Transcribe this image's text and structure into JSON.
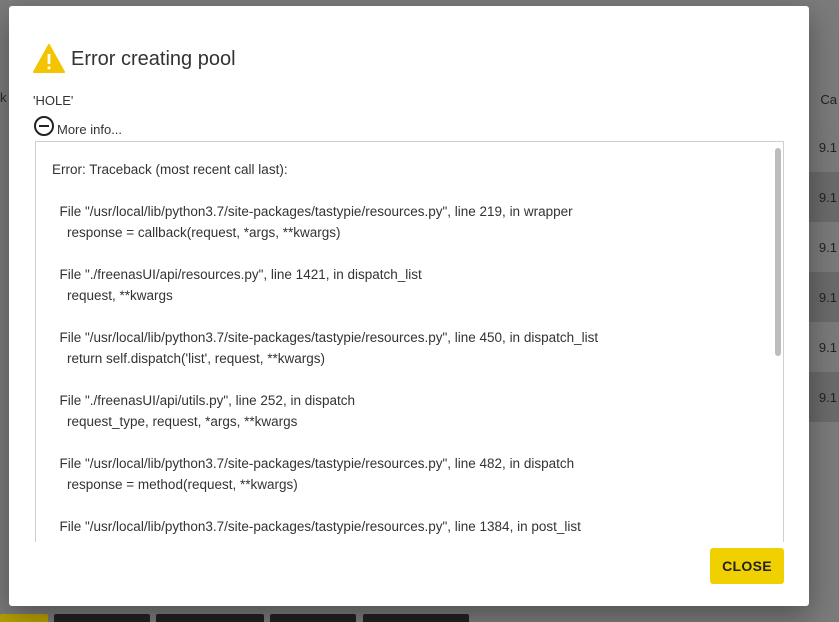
{
  "dialog": {
    "title": "Error creating pool",
    "message": "'HOLE'",
    "more_info_label": "More info...",
    "traceback": "Error: Traceback (most recent call last):\n\n  File \"/usr/local/lib/python3.7/site-packages/tastypie/resources.py\", line 219, in wrapper\n    response = callback(request, *args, **kwargs)\n\n  File \"./freenasUI/api/resources.py\", line 1421, in dispatch_list\n    request, **kwargs\n\n  File \"/usr/local/lib/python3.7/site-packages/tastypie/resources.py\", line 450, in dispatch_list\n    return self.dispatch('list', request, **kwargs)\n\n  File \"./freenasUI/api/utils.py\", line 252, in dispatch\n    request_type, request, *args, **kwargs\n\n  File \"/usr/local/lib/python3.7/site-packages/tastypie/resources.py\", line 482, in dispatch\n    response = method(request, **kwargs)\n\n  File \"/usr/local/lib/python3.7/site-packages/tastypie/resources.py\", line 1384, in post_list",
    "close_label": "CLOSE",
    "icons": {
      "warning": "warning-icon",
      "collapse": "minus-circle-icon"
    }
  },
  "background": {
    "header_partial": "Ca",
    "left_partial": "k",
    "values": [
      "9.1",
      "9.1",
      "9.1",
      "9.1",
      "9.1",
      "9.1"
    ]
  },
  "colors": {
    "accent": "#f0d000",
    "warning": "#f5c400",
    "overlay": "#7b7b7b"
  }
}
